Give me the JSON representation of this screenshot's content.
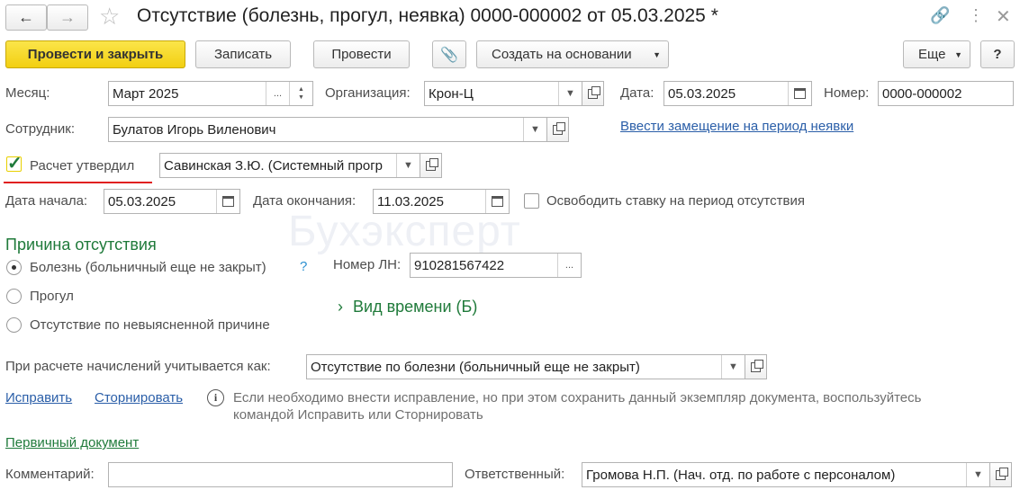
{
  "window": {
    "title": "Отсутствие (болезнь, прогул, неявка) 0000-000002 от 05.03.2025 *"
  },
  "toolbar": {
    "post_close": "Провести и закрыть",
    "save": "Записать",
    "post": "Провести",
    "create_based": "Создать на основании",
    "more": "Еще",
    "help": "?"
  },
  "header": {
    "month_label": "Месяц:",
    "month_value": "Март 2025",
    "org_label": "Организация:",
    "org_value": "Крон-Ц",
    "date_label": "Дата:",
    "date_value": "05.03.2025",
    "number_label": "Номер:",
    "number_value": "0000-000002",
    "employee_label": "Сотрудник:",
    "employee_value": "Булатов Игорь Виленович",
    "replacement_link": "Ввести замещение на период неявки",
    "approved_label": "Расчет утвердил",
    "approved_checked": true,
    "approver_value": "Савинская З.Ю. (Системный прогр",
    "start_label": "Дата начала:",
    "start_value": "05.03.2025",
    "end_label": "Дата окончания:",
    "end_value": "11.03.2025",
    "free_rate_label": "Освободить ставку на период отсутствия"
  },
  "reason": {
    "title": "Причина отсутствия",
    "options": [
      "Болезнь (больничный еще не закрыт)",
      "Прогул",
      "Отсутствие по невыясненной причине"
    ],
    "selected_index": 0,
    "help_mark": "?",
    "ln_label": "Номер ЛН:",
    "ln_value": "910281567422",
    "time_kind": "Вид времени (Б)"
  },
  "accrual": {
    "label": "При расчете начислений учитывается как:",
    "value": "Отсутствие по болезни (больничный еще не закрыт)"
  },
  "actions": {
    "fix": "Исправить",
    "storno": "Сторнировать",
    "info_line1": "Если необходимо внести исправление, но при этом сохранить данный экземпляр документа, воспользуйтесь",
    "info_line2": "командой Исправить или Сторнировать",
    "primary_doc": "Первичный документ"
  },
  "footer": {
    "comment_label": "Комментарий:",
    "comment_value": "",
    "responsible_label": "Ответственный:",
    "responsible_value": "Громова Н.П. (Нач. отд. по работе с персоналом)"
  },
  "watermark": "Бухэксперт",
  "colors": {
    "primary_button": "#f2cf11",
    "link": "#2a5ea8",
    "section_title": "#1f7a3a",
    "highlight_underline": "#e02020"
  }
}
